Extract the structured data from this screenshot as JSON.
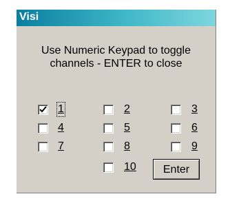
{
  "window": {
    "title": "Visi"
  },
  "instructions": [
    "Use Numeric Keypad to toggle",
    "channels - ENTER to close"
  ],
  "channels": [
    {
      "label": "1",
      "checked": true
    },
    {
      "label": "2",
      "checked": false
    },
    {
      "label": "3",
      "checked": false
    },
    {
      "label": "4",
      "checked": false
    },
    {
      "label": "5",
      "checked": false
    },
    {
      "label": "6",
      "checked": false
    },
    {
      "label": "7",
      "checked": false
    },
    {
      "label": "8",
      "checked": false
    },
    {
      "label": "9",
      "checked": false
    },
    {
      "label": "10",
      "checked": false
    }
  ],
  "buttons": {
    "enter_label": "Enter"
  }
}
